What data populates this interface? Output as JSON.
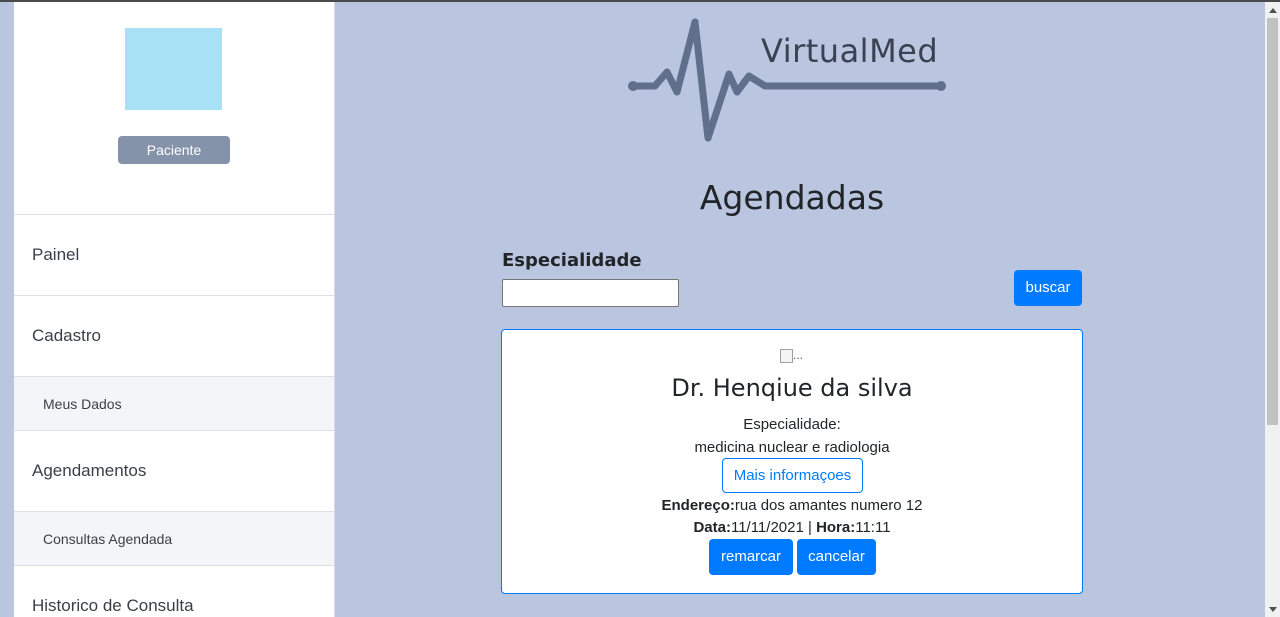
{
  "sidebar": {
    "role_label": "Paciente",
    "items": [
      {
        "label": "Painel",
        "type": "main"
      },
      {
        "label": "Cadastro",
        "type": "main"
      },
      {
        "label": "Meus Dados",
        "type": "sub"
      },
      {
        "label": "Agendamentos",
        "type": "main"
      },
      {
        "label": "Consultas Agendada",
        "type": "sub"
      },
      {
        "label": "Historico de Consulta",
        "type": "main"
      }
    ]
  },
  "logo": {
    "text": "VirtualMed",
    "color": "#5f6f8c"
  },
  "page": {
    "title": "Agendadas"
  },
  "filter": {
    "label": "Especialidade",
    "value": "",
    "placeholder": "",
    "button": "buscar"
  },
  "card": {
    "image_alt": "...",
    "doctor": "Dr. Henqiue da silva",
    "specialty_label": "Especialidade:",
    "specialty": "medicina nuclear e radiologia",
    "more_button": "Mais informaçoes",
    "address_label": "Endereço:",
    "address": "rua dos amantes numero 12",
    "date_label": "Data:",
    "date": "11/11/2021",
    "separator": " | ",
    "time_label": "Hora:",
    "time": "11:11",
    "reschedule_button": "remarcar",
    "cancel_button": "cancelar"
  },
  "colors": {
    "background": "#bac5e0",
    "primary": "#007bff",
    "role_button": "#8593aa",
    "avatar": "#a8e1f6"
  }
}
